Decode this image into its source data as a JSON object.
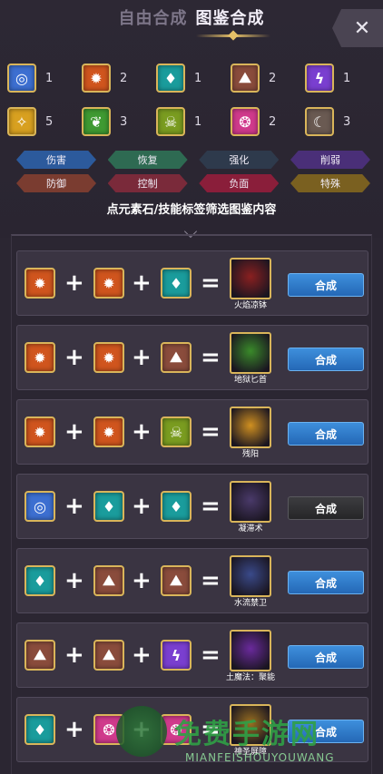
{
  "header": {
    "tab_free": "自由合成",
    "tab_atlas": "图鉴合成",
    "close_label": "✕"
  },
  "elements": [
    {
      "name": "wind",
      "glyph": "◎",
      "color": "#3d6fd1",
      "count": "1"
    },
    {
      "name": "fire",
      "glyph": "✹",
      "color": "#d0551e",
      "count": "2"
    },
    {
      "name": "water",
      "glyph": "♦",
      "color": "#1a9c9c",
      "count": "1"
    },
    {
      "name": "earth",
      "glyph": "⛰",
      "color": "#8a4c3c",
      "count": "2"
    },
    {
      "name": "thunder",
      "glyph": "ϟ",
      "color": "#7a3fd0",
      "count": "1"
    },
    {
      "name": "light",
      "glyph": "✧",
      "color": "#d8a020",
      "count": "5"
    },
    {
      "name": "leaf",
      "glyph": "❦",
      "color": "#3f9a32",
      "count": "3"
    },
    {
      "name": "poison",
      "glyph": "☠",
      "color": "#7a9c20",
      "count": "1"
    },
    {
      "name": "charm",
      "glyph": "❂",
      "color": "#d03a8c",
      "count": "2"
    },
    {
      "name": "moon",
      "glyph": "☾",
      "color": "#6a5a52",
      "count": "3"
    }
  ],
  "tags": [
    {
      "label": "伤害",
      "color": "#2c5a9c"
    },
    {
      "label": "恢复",
      "color": "#2e6a52"
    },
    {
      "label": "强化",
      "color": "#2e3a4c"
    },
    {
      "label": "削弱",
      "color": "#4a2f78"
    },
    {
      "label": "防御",
      "color": "#7a3c30"
    },
    {
      "label": "控制",
      "color": "#7a2a3a"
    },
    {
      "label": "负面",
      "color": "#8a1e3a"
    },
    {
      "label": "特殊",
      "color": "#7a6020"
    }
  ],
  "hint": "点元素石/技能标签筛选图鉴内容",
  "recipes": [
    {
      "ingredients": [
        "fire",
        "fire",
        "water"
      ],
      "result": "火焰凉钵",
      "result_color": "#8a2020",
      "enabled": true,
      "button": "合成"
    },
    {
      "ingredients": [
        "fire",
        "fire",
        "earth"
      ],
      "result": "地狱匕首",
      "result_color": "#3a8a2a",
      "enabled": true,
      "button": "合成"
    },
    {
      "ingredients": [
        "fire",
        "fire",
        "poison"
      ],
      "result": "残阳",
      "result_color": "#d09020",
      "enabled": true,
      "button": "合成"
    },
    {
      "ingredients": [
        "wind",
        "water",
        "water"
      ],
      "result": "凝滞术",
      "result_color": "#4a3a6a",
      "enabled": false,
      "button": "合成"
    },
    {
      "ingredients": [
        "water",
        "earth",
        "earth"
      ],
      "result": "水流禁卫",
      "result_color": "#3a4a8a",
      "enabled": true,
      "button": "合成"
    },
    {
      "ingredients": [
        "earth",
        "earth",
        "thunder"
      ],
      "result": "土魔法：聚能",
      "result_color": "#6a2a9c",
      "enabled": true,
      "button": "合成"
    },
    {
      "ingredients": [
        "water",
        "charm",
        "charm"
      ],
      "result": "神圣屏障",
      "result_color": "#9a7020",
      "enabled": true,
      "button": "合成"
    }
  ],
  "watermark": {
    "text": "免费手游网",
    "sub": "MIANFEISHOUYOUWANG"
  }
}
